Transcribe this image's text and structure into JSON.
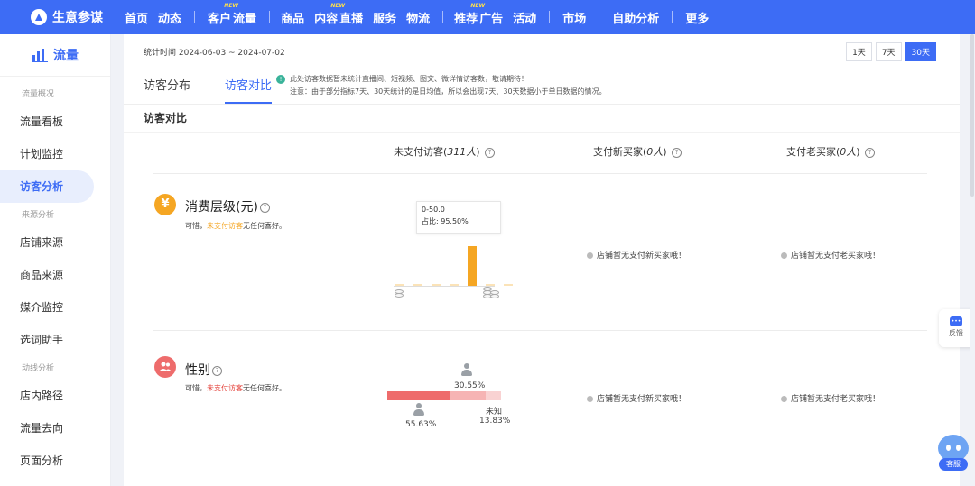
{
  "brand": {
    "title": "生意参谋"
  },
  "nav": {
    "items": [
      {
        "label": "首页",
        "badge": ""
      },
      {
        "label": "动态",
        "badge": ""
      },
      {
        "label": "客户",
        "badge": "NEW"
      },
      {
        "label": "流量",
        "badge": ""
      },
      {
        "label": "商品",
        "badge": ""
      },
      {
        "label": "内容",
        "badge": "NEW"
      },
      {
        "label": "直播",
        "badge": ""
      },
      {
        "label": "服务",
        "badge": ""
      },
      {
        "label": "物流",
        "badge": ""
      },
      {
        "label": "推荐",
        "badge": "NEW"
      },
      {
        "label": "广告",
        "badge": ""
      },
      {
        "label": "活动",
        "badge": ""
      },
      {
        "label": "市场",
        "badge": ""
      },
      {
        "label": "自助分析",
        "badge": ""
      },
      {
        "label": "更多",
        "badge": ""
      }
    ]
  },
  "sidebar": {
    "title": "流量",
    "groups": [
      {
        "label": "流量概况",
        "items": [
          "流量看板",
          "计划监控",
          "访客分析"
        ]
      },
      {
        "label": "来源分析",
        "items": [
          "店铺来源",
          "商品来源",
          "媒介监控",
          "选词助手"
        ]
      },
      {
        "label": "动线分析",
        "items": [
          "店内路径",
          "流量去向",
          "页面分析"
        ]
      }
    ],
    "active": "访客分析"
  },
  "stats": {
    "period": "统计时间 2024-06-03 ~ 2024-07-02",
    "ranges": [
      "1天",
      "7天",
      "30天"
    ],
    "active_range": "30天"
  },
  "tabs": {
    "items": [
      "访客分布",
      "访客对比"
    ],
    "active": "访客对比"
  },
  "notice": {
    "line1": "此处访客数据暂未统计直播间、短视频、图文、微详情访客数，敬请期待！",
    "line2": "注意：由于部分指标7天、30天统计的是日均值，所以会出现7天、30天数据小于单日数据的情况。"
  },
  "section": {
    "title": "访客对比"
  },
  "columns": {
    "unpaid": {
      "prefix": "未支付访客(",
      "count": "311人",
      "suffix": ")"
    },
    "new_buyer": {
      "prefix": "支付新买家(",
      "count": "0人",
      "suffix": ")"
    },
    "old_buyer": {
      "prefix": "支付老买家(",
      "count": "0人",
      "suffix": ")"
    }
  },
  "consumption": {
    "title": "消费层级(元)",
    "note_prefix": "可惜，",
    "note_highlight": "未支付访客",
    "note_suffix": "无任何喜好。",
    "icon": "yen-icon",
    "color": "#f5a623",
    "tooltip": {
      "range": "0-50.0",
      "share": "占比:  95.50%"
    },
    "chart_data": {
      "type": "bar",
      "values": [
        1.0,
        1.5,
        1.0,
        1.0,
        95.5,
        0.5,
        0.5
      ],
      "ylim": [
        0,
        100
      ]
    }
  },
  "gender": {
    "title": "性别",
    "note_prefix": "可惜，",
    "note_highlight": "未支付访客",
    "note_suffix": "无任何喜好。",
    "icon": "users-icon",
    "color": "#ee6c6c",
    "segments": [
      {
        "label": "",
        "value": 55.63,
        "pct": "55.63%",
        "color": "#ee6c6c"
      },
      {
        "label": "",
        "value": 30.55,
        "pct": "30.55%",
        "color": "#f6b4b4"
      },
      {
        "label": "未知",
        "value": 13.83,
        "pct": "13.83%",
        "color": "#f9d2d2"
      }
    ]
  },
  "empty": {
    "new_buyer": "店铺暂无支付新买家哦！",
    "old_buyer": "店铺暂无支付老买家哦！"
  },
  "float": {
    "feedback": "反馈",
    "service": "客服"
  },
  "colors": {
    "accent": "#3d6cf5",
    "orange": "#f5a623",
    "red": "#e4453e"
  }
}
